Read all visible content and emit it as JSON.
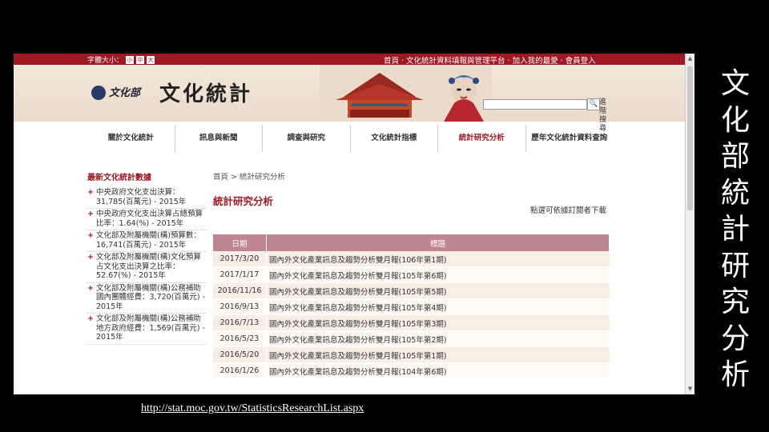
{
  "slide": {
    "title_chars": [
      "文",
      "化",
      "部",
      "統",
      "計",
      "研",
      "究",
      "分",
      "析"
    ],
    "url": "http://stat.moc.gov.tw/StatisticsResearchList.aspx"
  },
  "site": {
    "font_size_label": "字體大小：",
    "font_size_options": [
      "小",
      "中",
      "大"
    ],
    "top_links": "首頁 ‧ 文化統計資料填報與管理平台 ‧ 加入我的最愛 ‧ 會員登入",
    "logo_text": "文化部",
    "title": "文化統計",
    "search_placeholder": "",
    "search_button": "🔍",
    "advanced_search": "進階搜尋"
  },
  "nav": {
    "items": [
      {
        "label": "關於文化統計"
      },
      {
        "label": "訊息與新聞"
      },
      {
        "label": "調查與研究"
      },
      {
        "label": "文化統計指標"
      },
      {
        "label": "統計研究分析"
      },
      {
        "label": "歷年文化統計資料查詢"
      }
    ],
    "active_index": 4
  },
  "sidebar": {
    "heading": "最新文化統計數據",
    "items": [
      {
        "text": "中央政府文化支出決算：31,785(百萬元) - 2015年"
      },
      {
        "text": "中央政府文化支出決算占總預算比率：1.64(%) - 2015年"
      },
      {
        "text": "文化部及附屬機關(構)預算數：16,741(百萬元) - 2015年"
      },
      {
        "text": "文化部及附屬機關(構)文化預算占文化支出決算之比率：52.67(%) - 2015年"
      },
      {
        "text": "文化部及附屬機關(構)公務補助國內團體經費：3,720(百萬元) - 2015年"
      },
      {
        "text": "文化部及附屬機關(構)公務補助地方政府經費：1,569(百萬元) - 2015年"
      }
    ]
  },
  "main": {
    "breadcrumb": "首頁 > 統計研究分析",
    "heading": "統計研究分析",
    "sort_note": "點選可依據訂閱者下載",
    "columns": [
      "日期",
      "標題"
    ],
    "rows": [
      {
        "date": "2017/3/20",
        "title": "國內外文化產業訊息及趨勢分析雙月報(106年第1期)"
      },
      {
        "date": "2017/1/17",
        "title": "國內外文化產業訊息及趨勢分析雙月報(105年第6期)"
      },
      {
        "date": "2016/11/16",
        "title": "國內外文化產業訊息及趨勢分析雙月報(105年第5期)"
      },
      {
        "date": "2016/9/13",
        "title": "國內外文化產業訊息及趨勢分析雙月報(105年第4期)"
      },
      {
        "date": "2016/7/13",
        "title": "國內外文化產業訊息及趨勢分析雙月報(105年第3期)"
      },
      {
        "date": "2016/5/23",
        "title": "國內外文化產業訊息及趨勢分析雙月報(105年第2期)"
      },
      {
        "date": "2016/5/20",
        "title": "國內外文化產業訊息及趨勢分析雙月報(105年第1期)"
      },
      {
        "date": "2016/1/26",
        "title": "國內外文化產業訊息及趨勢分析雙月報(104年第6期)"
      }
    ]
  },
  "colors": {
    "brand_red": "#a01822",
    "table_header": "#c08690",
    "background": "#000000"
  }
}
